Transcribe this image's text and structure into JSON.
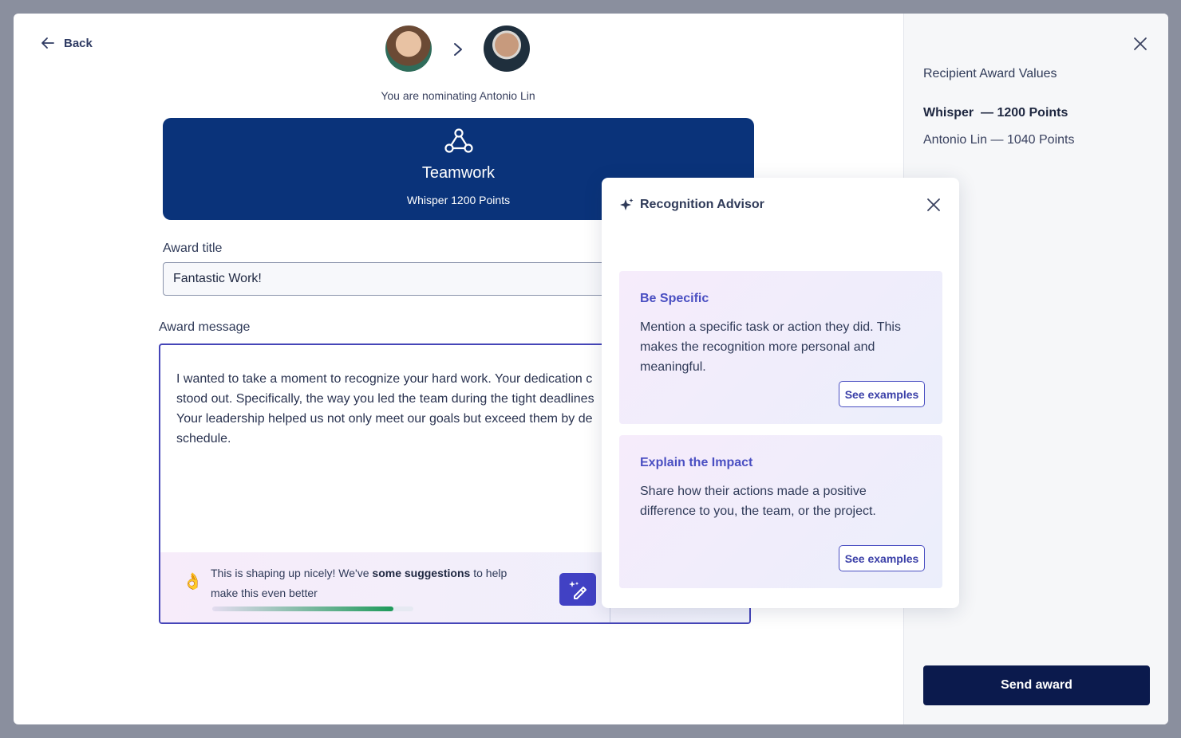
{
  "nav": {
    "back_label": "Back"
  },
  "header": {
    "nominating_text": "You are nominating Antonio Lin"
  },
  "award": {
    "title": "Teamwork",
    "subtitle": "Whisper 1200 Points"
  },
  "form": {
    "title_label": "Award title",
    "title_value": "Fantastic Work!",
    "message_label": "Award message",
    "message_lines": [
      "I wanted to take a moment to recognize your hard work. Your dedication c",
      "stood out. Specifically, the way you led the team during the tight deadlines",
      "Your leadership helped us not only meet our goals but exceed them by de",
      "schedule."
    ]
  },
  "suggestion": {
    "emoji": "👌",
    "text_before": "This is shaping up nicely! We've ",
    "text_bold": "some suggestions",
    "text_after": " to help make this even better",
    "progress": 0.9
  },
  "side_panel": {
    "heading": "Recipient Award Values",
    "value_1": "Whisper  — 1200 Points",
    "value_2": "Antonio Lin — 1040 Points",
    "send_label": "Send award"
  },
  "advisor": {
    "title": "Recognition Advisor",
    "tips": [
      {
        "title": "Be Specific",
        "text": "Mention a specific task or action they did. This makes the recognition more personal and meaningful.",
        "button": "See examples"
      },
      {
        "title": "Explain the Impact",
        "text": "Share how their actions made a positive difference to you, the team, or the project.",
        "button": "See examples"
      }
    ]
  },
  "colors": {
    "award_card": "#0a337a",
    "accent": "#4141c4",
    "send_button": "#0b1a4d",
    "progress": "#1e9a5a"
  }
}
